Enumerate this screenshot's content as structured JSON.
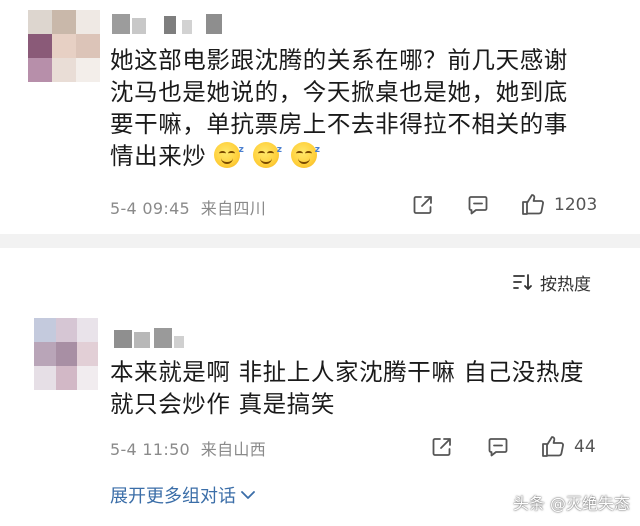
{
  "comments": [
    {
      "text_lines": [
        "她这部电影跟沈腾的关系在哪？前几天感谢",
        "沈马也是她说的，今天掀桌也是她，她到底",
        "要干嘛，单抗票房上不去非得拉不相关的事",
        "情出来炒"
      ],
      "emoji_count": 3,
      "emoji_icon": "sleepy-smile-emoji",
      "meta": "5-4 09:45  来自四川",
      "likes": "1203"
    },
    {
      "text_lines": [
        "本来就是啊 非扯上人家沈腾干嘛 自己没热度",
        "就只会炒作 真是搞笑"
      ],
      "meta": "5-4 11:50  来自山西",
      "likes": "44"
    }
  ],
  "sort_label": "按热度",
  "expand_label": "展开更多组对话",
  "watermark": "头条 @灭绝失态",
  "colors": {
    "link": "#3b6ea8",
    "meta": "#8a8a8a",
    "divider": "#f2f2f2"
  }
}
